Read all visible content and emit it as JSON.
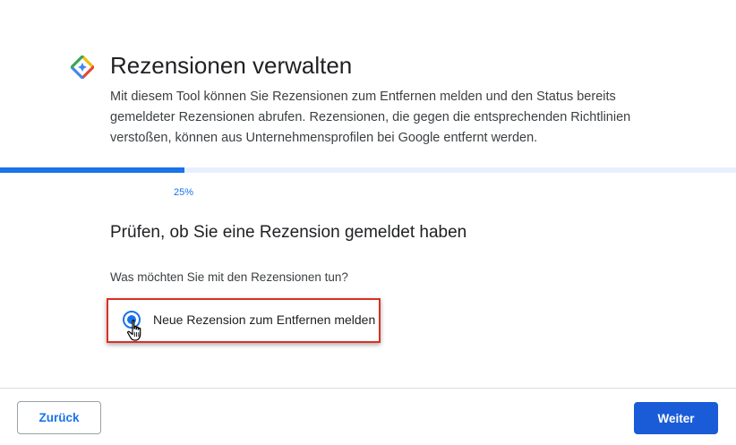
{
  "header": {
    "logo_icon": "google-maps-diamond-icon",
    "title": "Rezensionen verwalten",
    "description": "Mit diesem Tool können Sie Rezensionen zum Entfernen melden und den Status bereits gemeldeter Rezensionen abrufen. Rezensionen, die gegen die entsprechenden Richtlinien verstoßen, können aus Unternehmensprofilen bei Google entfernt werden."
  },
  "progress": {
    "value": 0.25,
    "label": "25%"
  },
  "section": {
    "title": "Prüfen, ob Sie eine Rezension gemeldet haben",
    "question": "Was möchten Sie mit den Rezensionen tun?",
    "options": [
      {
        "label": "Neue Rezension zum Entfernen melden",
        "selected": true
      }
    ]
  },
  "footer": {
    "back_label": "Zurück",
    "next_label": "Weiter"
  },
  "colors": {
    "accent": "#1a73e8",
    "highlight": "#d93025",
    "primary_button": "#1a5cd8"
  }
}
